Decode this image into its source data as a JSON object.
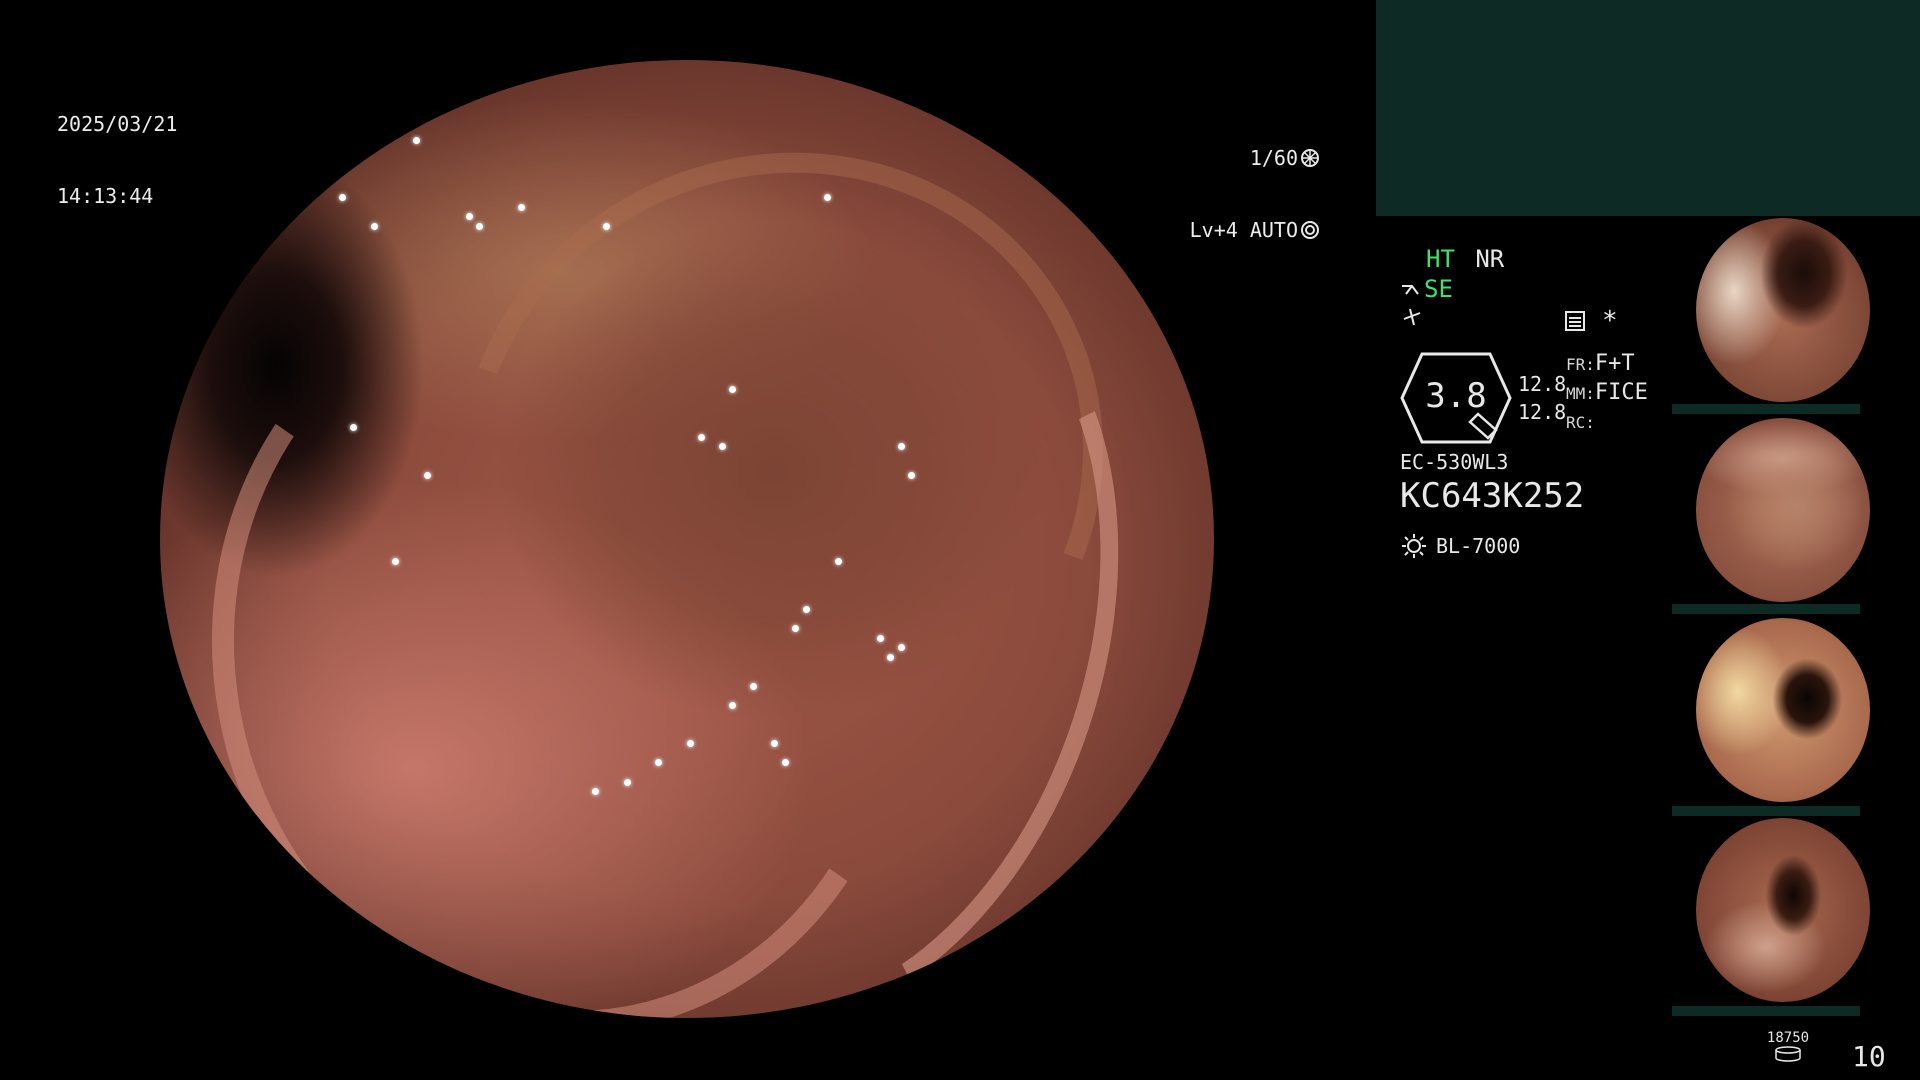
{
  "osd": {
    "date": "2025/03/21",
    "time": "14:13:44",
    "shutter": "1/60",
    "level": "Lv+4 AUTO"
  },
  "settings": {
    "ht": "HT",
    "nr": "NR",
    "se": "SE",
    "zoom": "3.8",
    "val1": "12.8",
    "val2": "12.8",
    "fr_label": "FR:",
    "fr_value": "F+T",
    "mm_label": "MM:",
    "mm_value": "FICE",
    "rc_label": "RC:",
    "star": "*"
  },
  "scope_info": {
    "model": "EC-530WL3",
    "serial": "KC643K252",
    "light_source": "BL-7000"
  },
  "footer": {
    "storage": "18750",
    "count": "10"
  },
  "colors": {
    "panel_teal": "#0e2a25",
    "status_green": "#3fe36a"
  },
  "icons": [
    "shutter-icon",
    "auto-iris-icon",
    "scope-angle-icon",
    "freeze-icon",
    "menu-icon",
    "lightsource-icon",
    "storage-icon"
  ]
}
